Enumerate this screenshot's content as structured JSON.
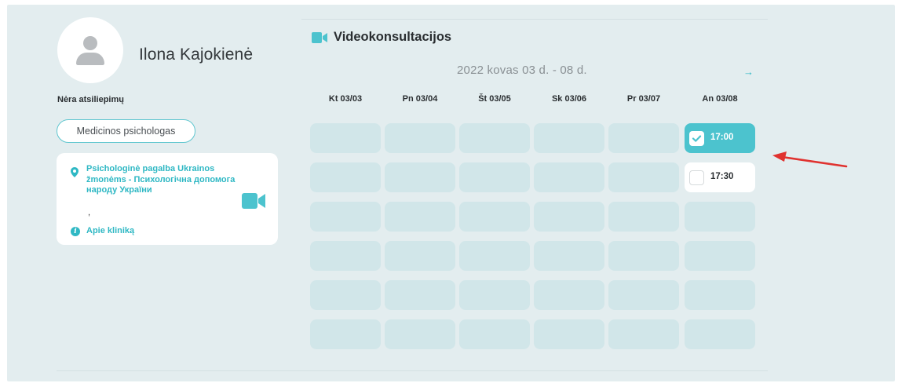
{
  "doctor": {
    "name": "Ilona Kajokienė",
    "reviews_text": "Nėra atsiliepimų",
    "specialty": "Medicinos psichologas"
  },
  "clinic": {
    "name": "Psichologinė pagalba Ukrainos žmonėms - Психологічна допомога народу України",
    "trailing": ",",
    "about_link": "Apie kliniką",
    "accent_color": "#2fb8c4"
  },
  "schedule": {
    "section_title": "Videokonsultacijos",
    "date_range": "2022 kovas 03 d. - 08 d.",
    "next_arrow": "→",
    "days": [
      {
        "label": "Kt 03/03"
      },
      {
        "label": "Pn 03/04"
      },
      {
        "label": "Št 03/05"
      },
      {
        "label": "Sk 03/06"
      },
      {
        "label": "Pr 03/07"
      },
      {
        "label": "An 03/08"
      }
    ],
    "available_slots": [
      {
        "day": "An 03/08",
        "time": "17:00",
        "selected": true
      },
      {
        "day": "An 03/08",
        "time": "17:30",
        "selected": false
      }
    ],
    "selected_color": "#4cc3ce",
    "empty_slot_color": "#d1e6e9"
  },
  "icons": {
    "avatar": "user-placeholder-icon",
    "location": "map-pin-icon",
    "video": "video-camera-icon",
    "info": "info-icon",
    "checkbox": "checkbox-icon",
    "arrow": "arrow-right-icon",
    "annotation": "red-arrow-annotation"
  }
}
